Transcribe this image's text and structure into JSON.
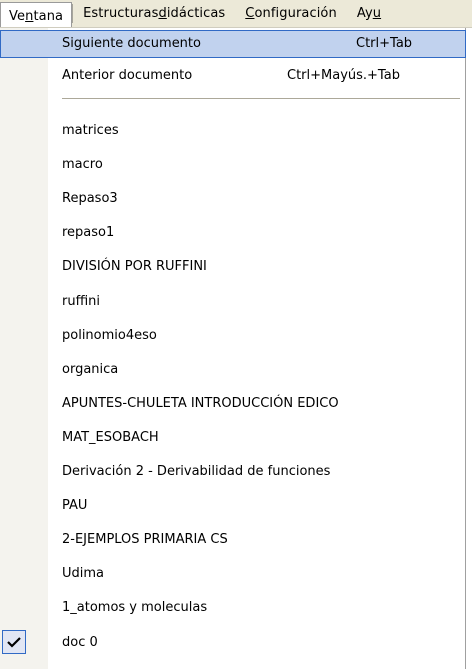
{
  "menubar": {
    "items": [
      {
        "label_pre": "Ve",
        "label_u": "n",
        "label_post": "tana"
      },
      {
        "label_pre": "Estructuras ",
        "label_u": "d",
        "label_post": "idácticas"
      },
      {
        "label_pre": "",
        "label_u": "C",
        "label_post": "onfiguración"
      },
      {
        "label_pre": "Ay",
        "label_u": "u",
        "label_post": ""
      }
    ]
  },
  "menu": {
    "next_doc": {
      "label": "Siguiente documento",
      "shortcut": "Ctrl+Tab"
    },
    "prev_doc": {
      "label": "Anterior documento",
      "shortcut": "Ctrl+Mayús.+Tab"
    },
    "documents": [
      "matrices",
      "macro",
      "Repaso3",
      "repaso1",
      "DIVISIÓN POR RUFFINI",
      "ruffini",
      "polinomio4eso",
      "organica",
      "APUNTES-CHULETA INTRODUCCIÓN EDICO",
      "MAT_ESOBACH",
      "Derivación 2 - Derivabilidad de funciones",
      "PAU",
      "2-EJEMPLOS PRIMARIA CS",
      "Udima",
      "1_atomos y moleculas",
      "doc 0"
    ],
    "checked_icon": "checkmark-icon"
  }
}
